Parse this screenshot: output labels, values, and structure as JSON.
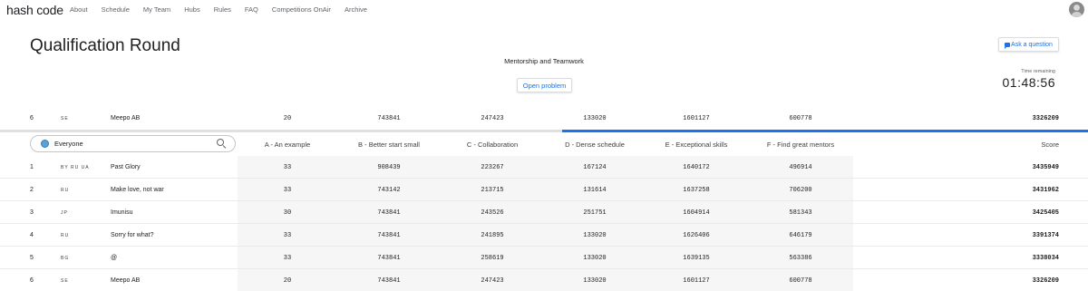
{
  "nav": {
    "logo": "hash code",
    "links": [
      "About",
      "Schedule",
      "My Team",
      "Hubs",
      "Rules",
      "FAQ",
      "Competitions OnAir",
      "Archive"
    ]
  },
  "header": {
    "title": "Qualification Round",
    "ask_button": "Ask a question",
    "subtitle": "Mentorship and Teamwork",
    "open_button": "Open problem",
    "time_label": "Time remaining",
    "time_value": "01:48:56"
  },
  "progress": {
    "fraction": 0.483
  },
  "sticky_row": {
    "rank": "6",
    "flags": "SE",
    "team": "Meepo AB",
    "scores": [
      "20",
      "743841",
      "247423",
      "133020",
      "1601127",
      "600778"
    ],
    "total": "3326209"
  },
  "filter": {
    "value": "Everyone"
  },
  "columns": [
    "A - An example",
    "B - Better start small",
    "C - Collaboration",
    "D - Dense schedule",
    "E - Exceptional skills",
    "F - Find great mentors"
  ],
  "score_header": "Score",
  "rows": [
    {
      "rank": "1",
      "flags": "BY RU UA",
      "team": "Past Glory",
      "scores": [
        "33",
        "908439",
        "223267",
        "167124",
        "1640172",
        "496914"
      ],
      "total": "3435949"
    },
    {
      "rank": "2",
      "flags": "RU",
      "team": "Make love, not war",
      "scores": [
        "33",
        "743142",
        "213715",
        "131614",
        "1637258",
        "706200"
      ],
      "total": "3431962"
    },
    {
      "rank": "3",
      "flags": "JP",
      "team": "Imunisu",
      "scores": [
        "30",
        "743841",
        "243526",
        "251751",
        "1604914",
        "581343"
      ],
      "total": "3425405"
    },
    {
      "rank": "4",
      "flags": "RU",
      "team": "Sorry for what?",
      "scores": [
        "33",
        "743841",
        "241895",
        "133020",
        "1626406",
        "646179"
      ],
      "total": "3391374"
    },
    {
      "rank": "5",
      "flags": "BG",
      "team": "@",
      "scores": [
        "33",
        "743841",
        "258619",
        "133020",
        "1639135",
        "563386"
      ],
      "total": "3338034"
    },
    {
      "rank": "6",
      "flags": "SE",
      "team": "Meepo AB",
      "scores": [
        "20",
        "743841",
        "247423",
        "133020",
        "1601127",
        "600778"
      ],
      "total": "3326209"
    }
  ]
}
